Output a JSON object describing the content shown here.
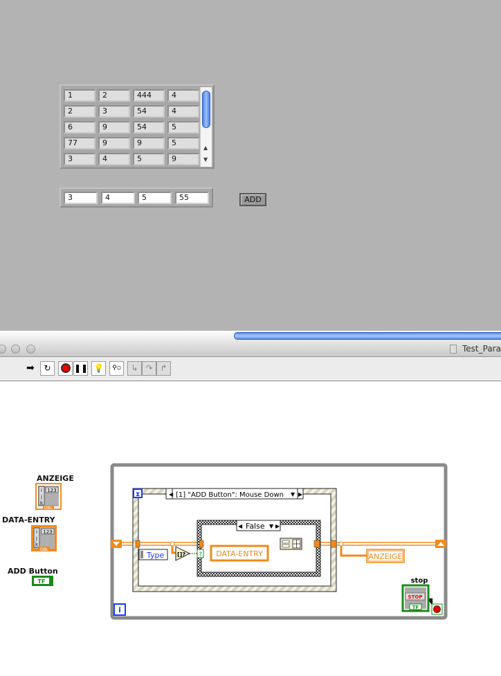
{
  "front_panel": {
    "display_array": {
      "rows": [
        [
          "1",
          "2",
          "444",
          "4"
        ],
        [
          "2",
          "3",
          "54",
          "4"
        ],
        [
          "6",
          "9",
          "54",
          "5"
        ],
        [
          "77",
          "9",
          "9",
          "5"
        ],
        [
          "3",
          "4",
          "5",
          "9"
        ]
      ]
    },
    "entry_array": {
      "values": [
        "3",
        "4",
        "5",
        "55"
      ]
    },
    "add_button_label": "ADD"
  },
  "window": {
    "title": "Test_Para",
    "toolbar": [
      "run-arrow",
      "run-continuously",
      "abort",
      "pause",
      "highlight-execution",
      "retain-wire-values",
      "step-into",
      "step-over",
      "step-out"
    ]
  },
  "block_diagram": {
    "terminals": {
      "anzeige": "ANZEIGE",
      "data_entry": "DATA-ENTRY",
      "add_button": "ADD Button",
      "numeric_type": "123",
      "dbl": "DBL",
      "bool_type": "TF",
      "index_i": "i",
      "index_j": "j",
      "index_k": "k"
    },
    "event_case": "[1] \"ADD Button\": Mouse Down",
    "case_selector": "False",
    "type_node": "Type",
    "data_entry_node": "DATA-ENTRY",
    "anzeige_node": "ANZEIGE",
    "stop_label": "stop",
    "stop_button": "STOP",
    "stop_tf": "TF",
    "iteration": "i",
    "question": "?",
    "colors": {
      "wire": "#f08a1c",
      "loop_border": "#8a8a8a",
      "event_border": "#d8d6c0",
      "bool": "#1a8a1a",
      "blue": "#1a3cf0"
    }
  }
}
